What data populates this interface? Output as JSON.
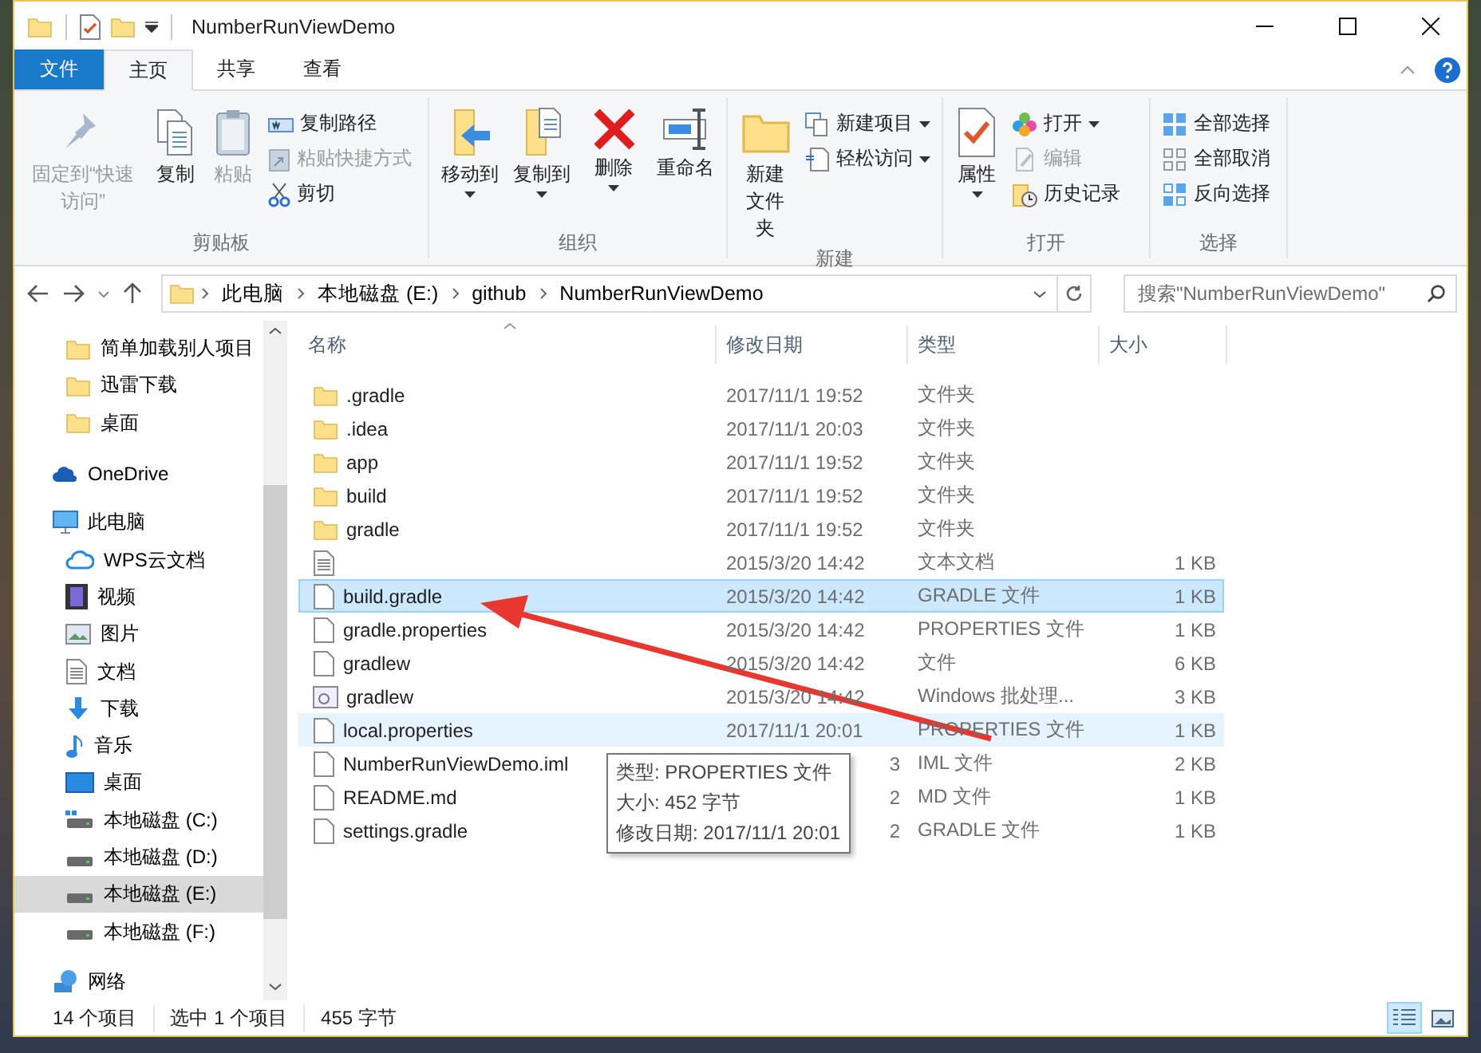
{
  "window": {
    "title": "NumberRunViewDemo"
  },
  "tabs": [
    {
      "label": "文件",
      "kind": "file_menu",
      "selected": false
    },
    {
      "label": "主页",
      "kind": "tab",
      "selected": true
    },
    {
      "label": "共享",
      "kind": "tab",
      "selected": false
    },
    {
      "label": "查看",
      "kind": "tab",
      "selected": false
    }
  ],
  "ribbon": {
    "groups": [
      {
        "label": "剪贴板",
        "large": [
          {
            "label": "固定到“快速访问”",
            "disabled": true,
            "dropdown": false
          },
          {
            "label": "复制",
            "disabled": false,
            "dropdown": false
          },
          {
            "label": "粘贴",
            "disabled": true,
            "dropdown": false
          }
        ],
        "small": [
          {
            "label": "复制路径",
            "disabled": false,
            "dropdown": false
          },
          {
            "label": "粘贴快捷方式",
            "disabled": true,
            "dropdown": false
          },
          {
            "label": "剪切",
            "disabled": false,
            "dropdown": false
          }
        ]
      },
      {
        "label": "组织",
        "large": [
          {
            "label": "移动到",
            "disabled": false,
            "dropdown": true
          },
          {
            "label": "复制到",
            "disabled": false,
            "dropdown": true
          },
          {
            "label": "删除",
            "disabled": false,
            "dropdown": true
          },
          {
            "label": "重命名",
            "disabled": false,
            "dropdown": false
          }
        ]
      },
      {
        "label": "新建",
        "large": [
          {
            "label": "新建文件夹",
            "disabled": false,
            "dropdown": false
          }
        ],
        "small": [
          {
            "label": "新建项目",
            "disabled": false,
            "dropdown": true
          },
          {
            "label": "轻松访问",
            "disabled": false,
            "dropdown": true
          }
        ]
      },
      {
        "label": "打开",
        "large": [
          {
            "label": "属性",
            "disabled": false,
            "dropdown": true
          }
        ],
        "small": [
          {
            "label": "打开",
            "disabled": false,
            "dropdown": true
          },
          {
            "label": "编辑",
            "disabled": true,
            "dropdown": false
          },
          {
            "label": "历史记录",
            "disabled": false,
            "dropdown": false
          }
        ]
      },
      {
        "label": "选择",
        "small": [
          {
            "label": "全部选择",
            "disabled": false,
            "dropdown": false
          },
          {
            "label": "全部取消",
            "disabled": false,
            "dropdown": false
          },
          {
            "label": "反向选择",
            "disabled": false,
            "dropdown": false
          }
        ]
      }
    ]
  },
  "address": {
    "path": [
      "此电脑",
      "本地磁盘 (E:)",
      "github",
      "NumberRunViewDemo"
    ]
  },
  "search": {
    "placeholder": "搜索\"NumberRunViewDemo\""
  },
  "sidebar": {
    "sections": [
      {
        "children": [
          {
            "label": "简单加载别人项目",
            "selected": false
          },
          {
            "label": "迅雷下载",
            "selected": false
          },
          {
            "label": "桌面",
            "selected": false
          }
        ]
      },
      {
        "label": "OneDrive",
        "selected": false
      },
      {
        "label": "此电脑",
        "selected": false,
        "children": [
          {
            "label": "WPS云文档",
            "selected": false
          },
          {
            "label": "视频",
            "selected": false
          },
          {
            "label": "图片",
            "selected": false
          },
          {
            "label": "文档",
            "selected": false
          },
          {
            "label": "下载",
            "selected": false
          },
          {
            "label": "音乐",
            "selected": false
          },
          {
            "label": "桌面",
            "selected": false
          },
          {
            "label": "本地磁盘 (C:)",
            "selected": false
          },
          {
            "label": "本地磁盘 (D:)",
            "selected": false
          },
          {
            "label": "本地磁盘 (E:)",
            "selected": true
          },
          {
            "label": "本地磁盘 (F:)",
            "selected": false
          }
        ]
      },
      {
        "label": "网络",
        "selected": false
      }
    ]
  },
  "table": {
    "columns": [
      "名称",
      "修改日期",
      "类型",
      "大小"
    ],
    "rows": [
      {
        "kind": "folder",
        "name": ".gradle",
        "modified": "2017/11/1 19:52",
        "type": "文件夹",
        "size": "",
        "selected": false,
        "hovered": false,
        "cut": false
      },
      {
        "kind": "folder",
        "name": ".idea",
        "modified": "2017/11/1 20:03",
        "type": "文件夹",
        "size": "",
        "selected": false,
        "hovered": false,
        "cut": false
      },
      {
        "kind": "folder",
        "name": "app",
        "modified": "2017/11/1 19:52",
        "type": "文件夹",
        "size": "",
        "selected": false,
        "hovered": false,
        "cut": false
      },
      {
        "kind": "folder",
        "name": "build",
        "modified": "2017/11/1 19:52",
        "type": "文件夹",
        "size": "",
        "selected": false,
        "hovered": false,
        "cut": false
      },
      {
        "kind": "folder",
        "name": "gradle",
        "modified": "2017/11/1 19:52",
        "type": "文件夹",
        "size": "",
        "selected": false,
        "hovered": false,
        "cut": false
      },
      {
        "kind": "text",
        "name": "",
        "modified": "2015/3/20 14:42",
        "type": "文本文档",
        "size": "1 KB",
        "selected": false,
        "hovered": false,
        "cut": false
      },
      {
        "kind": "file",
        "name": "build.gradle",
        "modified": "2015/3/20 14:42",
        "type": "GRADLE 文件",
        "size": "1 KB",
        "selected": true,
        "hovered": false,
        "cut": false
      },
      {
        "kind": "file",
        "name": "gradle.properties",
        "modified": "2015/3/20 14:42",
        "type": "PROPERTIES 文件",
        "size": "1 KB",
        "selected": false,
        "hovered": false,
        "cut": false
      },
      {
        "kind": "file",
        "name": "gradlew",
        "modified": "2015/3/20 14:42",
        "type": "文件",
        "size": "6 KB",
        "selected": false,
        "hovered": false,
        "cut": false
      },
      {
        "kind": "batch",
        "name": "gradlew",
        "modified": "2015/3/20 14:42",
        "type": "Windows 批处理...",
        "size": "3 KB",
        "selected": false,
        "hovered": false,
        "cut": false
      },
      {
        "kind": "file",
        "name": "local.properties",
        "modified": "2017/11/1 20:01",
        "type": "PROPERTIES 文件",
        "size": "1 KB",
        "selected": false,
        "hovered": true,
        "cut": false
      },
      {
        "kind": "file",
        "name": "NumberRunViewDemo.iml",
        "modified": "3",
        "type": "IML 文件",
        "size": "2 KB",
        "selected": false,
        "hovered": false,
        "cut": true
      },
      {
        "kind": "file",
        "name": "README.md",
        "modified": "2",
        "type": "MD 文件",
        "size": "1 KB",
        "selected": false,
        "hovered": false,
        "cut": true
      },
      {
        "kind": "file",
        "name": "settings.gradle",
        "modified": "2",
        "type": "GRADLE 文件",
        "size": "1 KB",
        "selected": false,
        "hovered": false,
        "cut": true
      }
    ]
  },
  "tooltip": {
    "lines": [
      "类型: PROPERTIES 文件",
      "大小: 452 字节",
      "修改日期: 2017/11/1 20:01"
    ]
  },
  "status_bar": {
    "items": [
      "14 个项目",
      "选中 1 个项目",
      "455 字节"
    ],
    "views": [
      {
        "selected": true
      },
      {
        "selected": false
      }
    ]
  }
}
